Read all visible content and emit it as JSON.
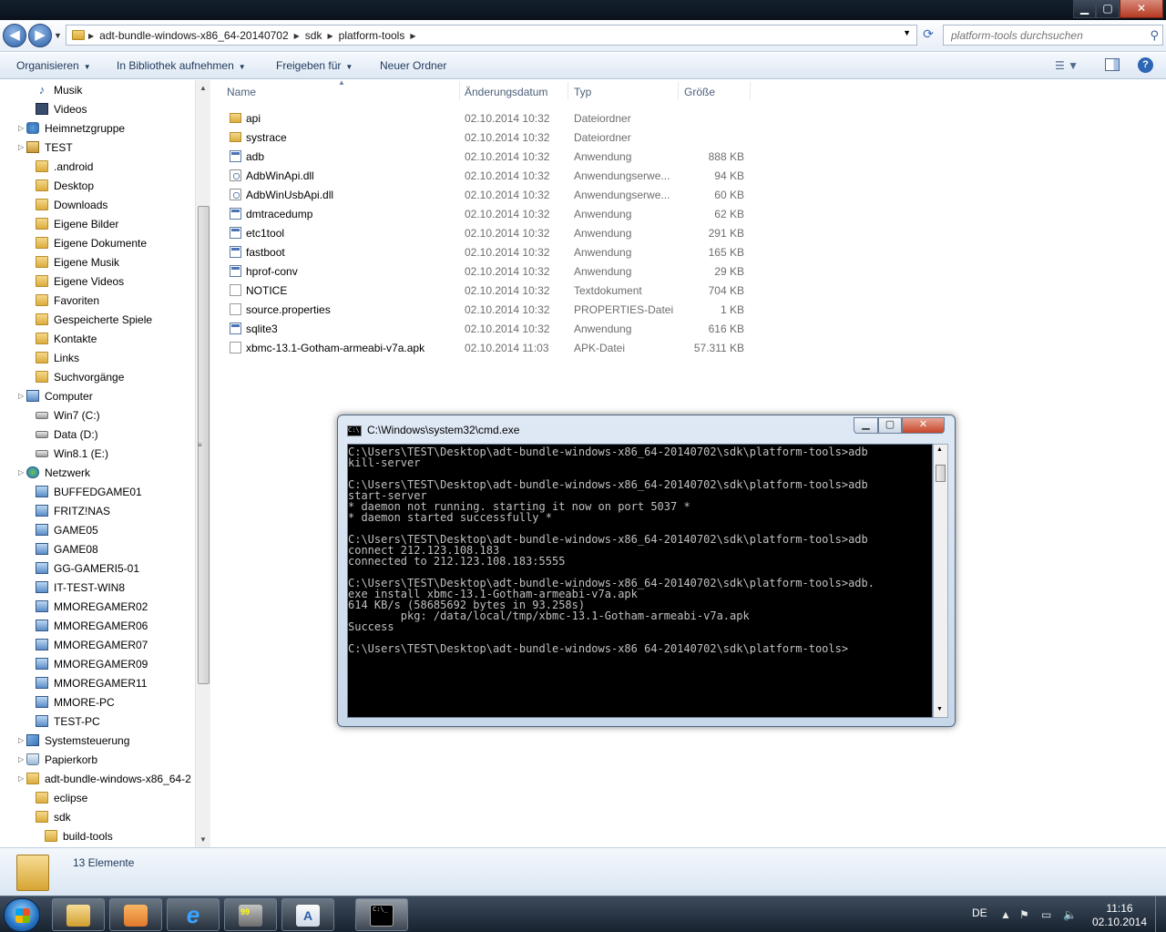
{
  "window": {
    "min": "▁",
    "max": "▢",
    "close": "✕"
  },
  "nav": {
    "back": "◀",
    "forward": "▶",
    "history": "▼",
    "breadcrumbs": [
      "adt-bundle-windows-x86_64-20140702",
      "sdk",
      "platform-tools"
    ],
    "search_placeholder": "platform-tools durchsuchen"
  },
  "commandbar": {
    "organize": "Organisieren",
    "include_library": "In Bibliothek aufnehmen",
    "share": "Freigeben für",
    "new_folder": "Neuer Ordner"
  },
  "sidebar": {
    "items": [
      {
        "label": "Musik",
        "icon": "music-icon",
        "indent": 1
      },
      {
        "label": "Videos",
        "icon": "video-icon",
        "indent": 1
      },
      {
        "label": "Heimnetzgruppe",
        "icon": "homegroup-icon",
        "indent": 0
      },
      {
        "label": "TEST",
        "icon": "user-folder-icon",
        "indent": 0
      },
      {
        "label": ".android",
        "icon": "folder-icon",
        "indent": 1
      },
      {
        "label": "Desktop",
        "icon": "folder-icon",
        "indent": 1
      },
      {
        "label": "Downloads",
        "icon": "folder-icon",
        "indent": 1
      },
      {
        "label": "Eigene Bilder",
        "icon": "folder-icon",
        "indent": 1
      },
      {
        "label": "Eigene Dokumente",
        "icon": "folder-icon",
        "indent": 1
      },
      {
        "label": "Eigene Musik",
        "icon": "folder-icon",
        "indent": 1
      },
      {
        "label": "Eigene Videos",
        "icon": "folder-icon",
        "indent": 1
      },
      {
        "label": "Favoriten",
        "icon": "folder-icon",
        "indent": 1
      },
      {
        "label": "Gespeicherte Spiele",
        "icon": "folder-icon",
        "indent": 1
      },
      {
        "label": "Kontakte",
        "icon": "folder-icon",
        "indent": 1
      },
      {
        "label": "Links",
        "icon": "folder-icon",
        "indent": 1
      },
      {
        "label": "Suchvorgänge",
        "icon": "folder-icon",
        "indent": 1
      },
      {
        "label": "Computer",
        "icon": "computer-icon",
        "indent": 0
      },
      {
        "label": "Win7 (C:)",
        "icon": "drive-icon",
        "indent": 1
      },
      {
        "label": "Data (D:)",
        "icon": "drive-icon",
        "indent": 1
      },
      {
        "label": "Win8.1 (E:)",
        "icon": "drive-icon",
        "indent": 1
      },
      {
        "label": "Netzwerk",
        "icon": "network-icon",
        "indent": 0
      },
      {
        "label": "BUFFEDGAME01",
        "icon": "computer-icon",
        "indent": 1
      },
      {
        "label": "FRITZ!NAS",
        "icon": "computer-icon",
        "indent": 1
      },
      {
        "label": "GAME05",
        "icon": "computer-icon",
        "indent": 1
      },
      {
        "label": "GAME08",
        "icon": "computer-icon",
        "indent": 1
      },
      {
        "label": "GG-GAMERI5-01",
        "icon": "computer-icon",
        "indent": 1
      },
      {
        "label": "IT-TEST-WIN8",
        "icon": "computer-icon",
        "indent": 1
      },
      {
        "label": "MMOREGAMER02",
        "icon": "computer-icon",
        "indent": 1
      },
      {
        "label": "MMOREGAMER06",
        "icon": "computer-icon",
        "indent": 1
      },
      {
        "label": "MMOREGAMER07",
        "icon": "computer-icon",
        "indent": 1
      },
      {
        "label": "MMOREGAMER09",
        "icon": "computer-icon",
        "indent": 1
      },
      {
        "label": "MMOREGAMER11",
        "icon": "computer-icon",
        "indent": 1
      },
      {
        "label": "MMORE-PC",
        "icon": "computer-icon",
        "indent": 1
      },
      {
        "label": "TEST-PC",
        "icon": "computer-icon",
        "indent": 1
      },
      {
        "label": "Systemsteuerung",
        "icon": "control-panel-icon",
        "indent": 0
      },
      {
        "label": "Papierkorb",
        "icon": "recycle-bin-icon",
        "indent": 0
      },
      {
        "label": "adt-bundle-windows-x86_64-2",
        "icon": "folder-icon",
        "indent": 0
      },
      {
        "label": "eclipse",
        "icon": "folder-icon",
        "indent": 1
      },
      {
        "label": "sdk",
        "icon": "folder-icon",
        "indent": 1
      },
      {
        "label": "build-tools",
        "icon": "folder-icon",
        "indent": 2
      }
    ]
  },
  "filelist": {
    "columns": {
      "name": "Name",
      "date": "Änderungsdatum",
      "type": "Typ",
      "size": "Größe"
    },
    "rows": [
      {
        "name": "api",
        "date": "02.10.2014 10:32",
        "type": "Dateiordner",
        "size": "",
        "icon": "folder-icon"
      },
      {
        "name": "systrace",
        "date": "02.10.2014 10:32",
        "type": "Dateiordner",
        "size": "",
        "icon": "folder-icon"
      },
      {
        "name": "adb",
        "date": "02.10.2014 10:32",
        "type": "Anwendung",
        "size": "888 KB",
        "icon": "exe-icon"
      },
      {
        "name": "AdbWinApi.dll",
        "date": "02.10.2014 10:32",
        "type": "Anwendungserwe...",
        "size": "94 KB",
        "icon": "dll-icon"
      },
      {
        "name": "AdbWinUsbApi.dll",
        "date": "02.10.2014 10:32",
        "type": "Anwendungserwe...",
        "size": "60 KB",
        "icon": "dll-icon"
      },
      {
        "name": "dmtracedump",
        "date": "02.10.2014 10:32",
        "type": "Anwendung",
        "size": "62 KB",
        "icon": "exe-icon"
      },
      {
        "name": "etc1tool",
        "date": "02.10.2014 10:32",
        "type": "Anwendung",
        "size": "291 KB",
        "icon": "exe-icon"
      },
      {
        "name": "fastboot",
        "date": "02.10.2014 10:32",
        "type": "Anwendung",
        "size": "165 KB",
        "icon": "exe-icon"
      },
      {
        "name": "hprof-conv",
        "date": "02.10.2014 10:32",
        "type": "Anwendung",
        "size": "29 KB",
        "icon": "exe-icon"
      },
      {
        "name": "NOTICE",
        "date": "02.10.2014 10:32",
        "type": "Textdokument",
        "size": "704 KB",
        "icon": "document-icon"
      },
      {
        "name": "source.properties",
        "date": "02.10.2014 10:32",
        "type": "PROPERTIES-Datei",
        "size": "1 KB",
        "icon": "document-icon"
      },
      {
        "name": "sqlite3",
        "date": "02.10.2014 10:32",
        "type": "Anwendung",
        "size": "616 KB",
        "icon": "exe-icon"
      },
      {
        "name": "xbmc-13.1-Gotham-armeabi-v7a.apk",
        "date": "02.10.2014 11:03",
        "type": "APK-Datei",
        "size": "57.311 KB",
        "icon": "document-icon"
      }
    ]
  },
  "cmd": {
    "title": "C:\\Windows\\system32\\cmd.exe",
    "lines": [
      "C:\\Users\\TEST\\Desktop\\adt-bundle-windows-x86_64-20140702\\sdk\\platform-tools>adb",
      "kill-server",
      "",
      "C:\\Users\\TEST\\Desktop\\adt-bundle-windows-x86_64-20140702\\sdk\\platform-tools>adb",
      "start-server",
      "* daemon not running. starting it now on port 5037 *",
      "* daemon started successfully *",
      "",
      "C:\\Users\\TEST\\Desktop\\adt-bundle-windows-x86_64-20140702\\sdk\\platform-tools>adb",
      "connect 212.123.108.183",
      "connected to 212.123.108.183:5555",
      "",
      "C:\\Users\\TEST\\Desktop\\adt-bundle-windows-x86_64-20140702\\sdk\\platform-tools>adb.",
      "exe install xbmc-13.1-Gotham-armeabi-v7a.apk",
      "614 KB/s (58685692 bytes in 93.258s)",
      "        pkg: /data/local/tmp/xbmc-13.1-Gotham-armeabi-v7a.apk",
      "Success",
      "",
      "C:\\Users\\TEST\\Desktop\\adt-bundle-windows-x86_64-20140702\\sdk\\platform-tools>"
    ]
  },
  "details": {
    "count": "13 Elemente"
  },
  "taskbar": {
    "lang": "DE",
    "time": "11:16",
    "date": "02.10.2014",
    "app_icon_label": "99",
    "cmd_icon_label": "C:\\_"
  }
}
